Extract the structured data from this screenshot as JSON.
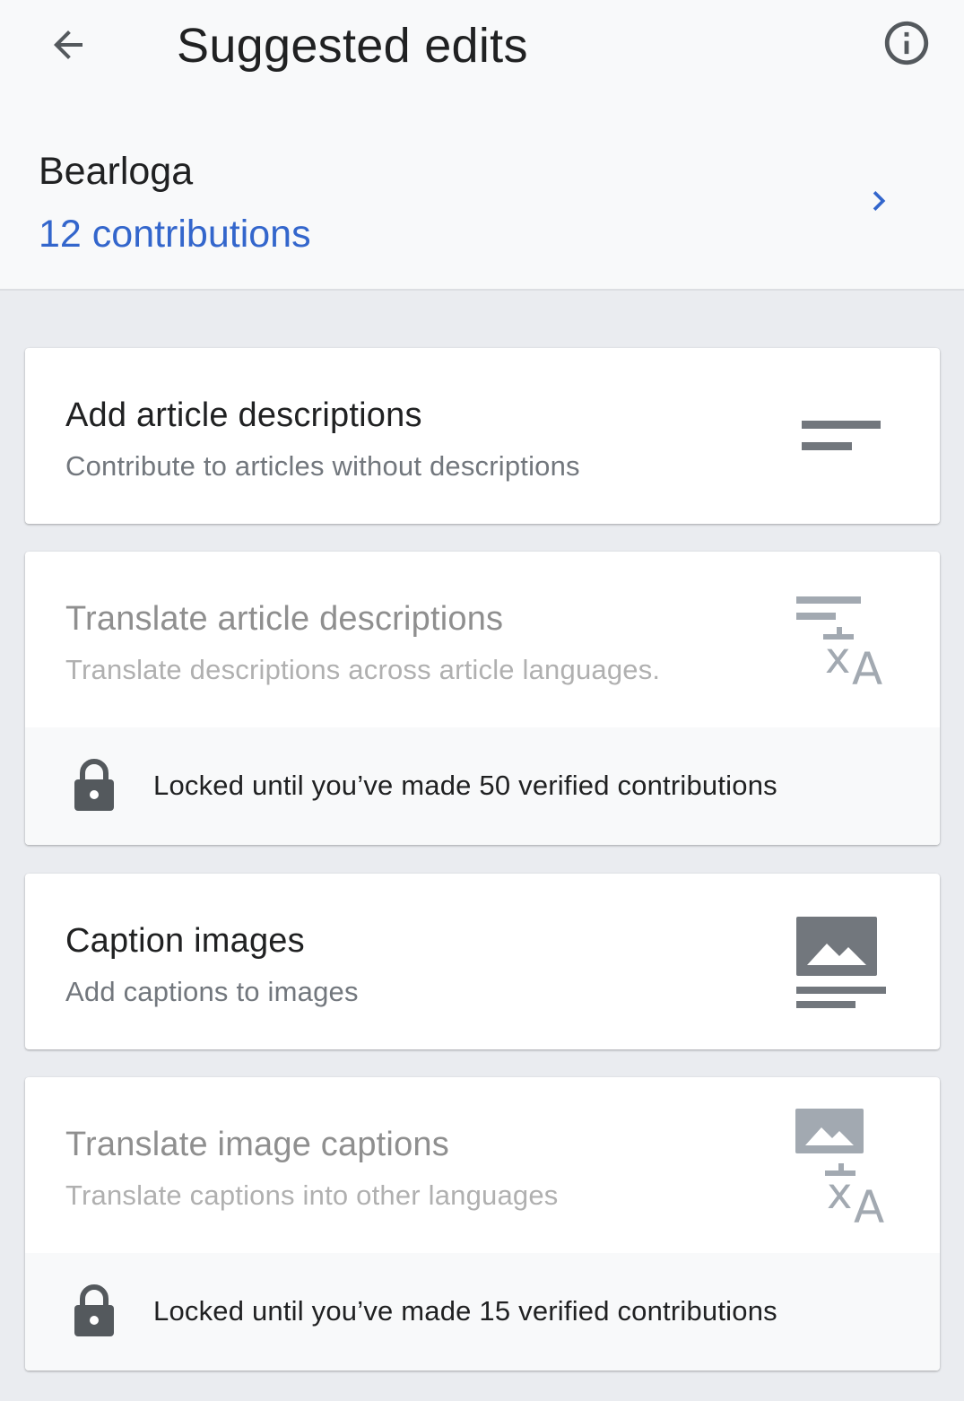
{
  "header": {
    "title": "Suggested edits",
    "back_icon": "arrow-back-icon",
    "info_icon": "info-icon"
  },
  "user": {
    "name": "Bearloga",
    "contributions": "12 contributions",
    "chevron_icon": "chevron-right-icon"
  },
  "cards": [
    {
      "title": "Add article descriptions",
      "subtitle": "Contribute to articles without descriptions",
      "icon": "short-text-icon",
      "locked": false
    },
    {
      "title": "Translate article descriptions",
      "subtitle": "Translate descriptions across article languages.",
      "icon": "translate-text-icon",
      "locked": true,
      "lock_text": "Locked until you’ve made 50 verified contributions"
    },
    {
      "title": "Caption images",
      "subtitle": "Add captions to images",
      "icon": "image-caption-icon",
      "locked": false
    },
    {
      "title": "Translate image captions",
      "subtitle": "Translate captions into other languages",
      "icon": "translate-image-icon",
      "locked": true,
      "lock_text": "Locked until you’ve made 15 verified contributions"
    }
  ],
  "colors": {
    "link": "#3366cc",
    "header_bg": "#f8f9fa",
    "page_bg": "#eaecf0",
    "text": "#202122",
    "icon": "#72777d",
    "disabled_icon": "#a2a9b1"
  }
}
